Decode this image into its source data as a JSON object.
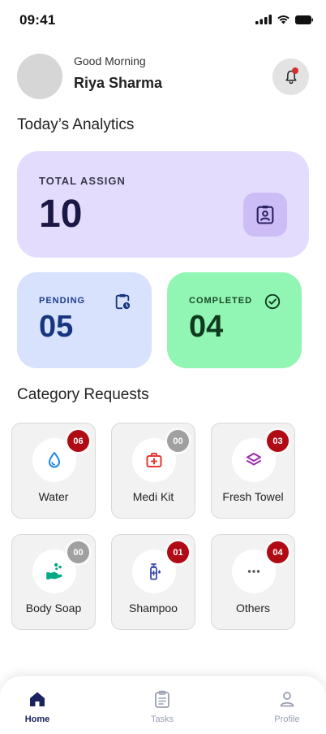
{
  "status_bar": {
    "time": "09:41",
    "icons": [
      "cellular-signal-icon",
      "wifi-icon",
      "battery-icon"
    ]
  },
  "header": {
    "greeting": "Good Morning",
    "user_name": "Riya Sharma",
    "notification_icon": "bell-icon"
  },
  "analytics": {
    "title": "Today’s Analytics",
    "total": {
      "label": "TOTAL ASSIGN",
      "value": "10",
      "icon": "clipboard-user-icon",
      "color": "#e4dcfd"
    },
    "pending": {
      "label": "PENDING",
      "value": "05",
      "icon": "clipboard-clock-icon",
      "color": "#d8e2fd"
    },
    "completed": {
      "label": "COMPLETED",
      "value": "04",
      "icon": "check-circle-icon",
      "color": "#91f5b3"
    }
  },
  "categories": {
    "title": "Category Requests",
    "items": [
      {
        "label": "Water",
        "count": "06",
        "icon": "water-drop-icon"
      },
      {
        "label": "Medi Kit",
        "count": "00",
        "icon": "medical-kit-icon"
      },
      {
        "label": "Fresh Towel",
        "count": "03",
        "icon": "layers-icon"
      },
      {
        "label": "Body Soap",
        "count": "00",
        "icon": "soap-icon"
      },
      {
        "label": "Shampoo",
        "count": "01",
        "icon": "shampoo-bottle-icon"
      },
      {
        "label": "Others",
        "count": "04",
        "icon": "more-dots-icon"
      }
    ]
  },
  "bottom_nav": {
    "items": [
      {
        "label": "Home",
        "icon": "home-icon",
        "active": true
      },
      {
        "label": "Tasks",
        "icon": "tasks-icon",
        "active": false
      },
      {
        "label": "Profile",
        "icon": "profile-icon",
        "active": false
      }
    ]
  }
}
